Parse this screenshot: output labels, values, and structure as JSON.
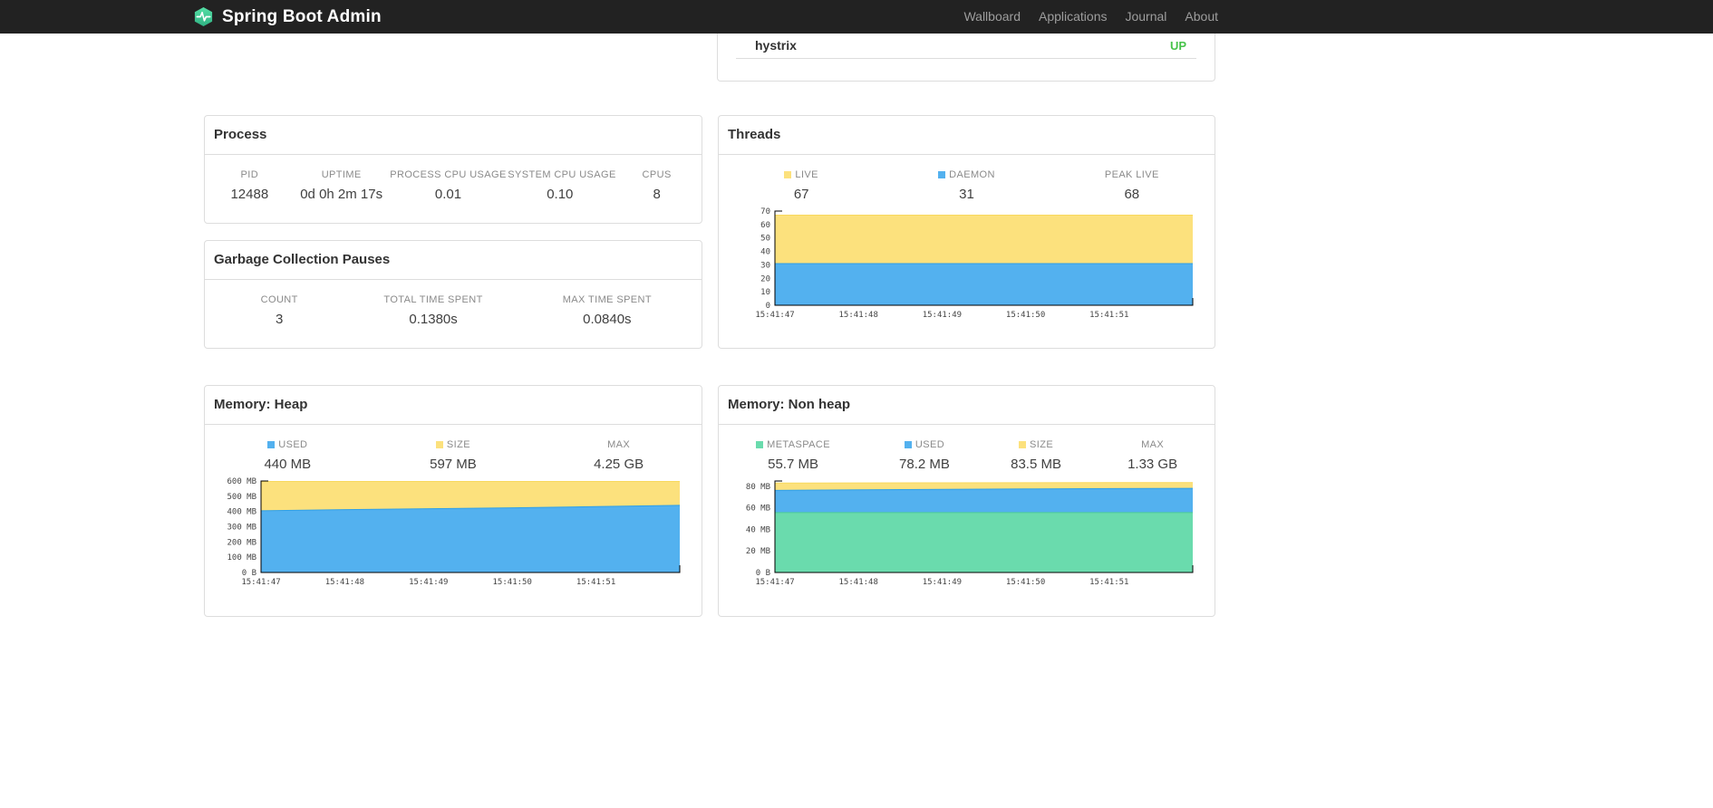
{
  "navbar": {
    "brand": "Spring Boot Admin",
    "links": [
      {
        "label": "Wallboard"
      },
      {
        "label": "Applications"
      },
      {
        "label": "Journal"
      },
      {
        "label": "About"
      }
    ]
  },
  "health": {
    "service": "hystrix",
    "status": "UP",
    "status_color": "#47c34a"
  },
  "process": {
    "title": "Process",
    "stats": [
      {
        "label": "PID",
        "value": "12488"
      },
      {
        "label": "UPTIME",
        "value": "0d 0h 2m 17s"
      },
      {
        "label": "PROCESS CPU USAGE",
        "value": "0.01"
      },
      {
        "label": "SYSTEM CPU USAGE",
        "value": "0.10"
      },
      {
        "label": "CPUS",
        "value": "8"
      }
    ]
  },
  "gc": {
    "title": "Garbage Collection Pauses",
    "stats": [
      {
        "label": "COUNT",
        "value": "3"
      },
      {
        "label": "TOTAL TIME SPENT",
        "value": "0.1380s"
      },
      {
        "label": "MAX TIME SPENT",
        "value": "0.0840s"
      }
    ]
  },
  "threads": {
    "title": "Threads",
    "stats": [
      {
        "label": "LIVE",
        "value": "67",
        "color": "#fce17d"
      },
      {
        "label": "DAEMON",
        "value": "31",
        "color": "#53b1ef"
      },
      {
        "label": "PEAK LIVE",
        "value": "68"
      }
    ],
    "chart": {
      "type": "area",
      "x_labels": [
        "15:41:47",
        "15:41:48",
        "15:41:49",
        "15:41:50",
        "15:41:51"
      ],
      "y_max": 70,
      "y_ticks": [
        {
          "v": 0,
          "t": "0"
        },
        {
          "v": 10,
          "t": "10"
        },
        {
          "v": 20,
          "t": "20"
        },
        {
          "v": 30,
          "t": "30"
        },
        {
          "v": 40,
          "t": "40"
        },
        {
          "v": 50,
          "t": "50"
        },
        {
          "v": 60,
          "t": "60"
        },
        {
          "v": 70,
          "t": "70"
        }
      ],
      "series": [
        {
          "name": "DAEMON",
          "color": "#53b1ef",
          "line": "#2e9fe8",
          "values": [
            31,
            31,
            31,
            31,
            31,
            31
          ]
        },
        {
          "name": "LIVE",
          "color": "#fce17d",
          "line": "#f8d95e",
          "values": [
            67,
            67,
            67,
            67,
            67,
            67
          ]
        }
      ]
    }
  },
  "heap": {
    "title": "Memory: Heap",
    "stats": [
      {
        "label": "USED",
        "value": "440 MB",
        "color": "#53b1ef"
      },
      {
        "label": "SIZE",
        "value": "597 MB",
        "color": "#fce17d"
      },
      {
        "label": "MAX",
        "value": "4.25 GB"
      }
    ],
    "chart": {
      "type": "area",
      "x_labels": [
        "15:41:47",
        "15:41:48",
        "15:41:49",
        "15:41:50",
        "15:41:51"
      ],
      "y_max": 600,
      "y_ticks": [
        {
          "v": 0,
          "t": "0 B"
        },
        {
          "v": 100,
          "t": "100 MB"
        },
        {
          "v": 200,
          "t": "200 MB"
        },
        {
          "v": 300,
          "t": "300 MB"
        },
        {
          "v": 400,
          "t": "400 MB"
        },
        {
          "v": 500,
          "t": "500 MB"
        },
        {
          "v": 600,
          "t": "600 MB"
        }
      ],
      "series": [
        {
          "name": "USED",
          "color": "#53b1ef",
          "line": "#2e9fe8",
          "values": [
            405,
            412,
            418,
            424,
            432,
            440
          ]
        },
        {
          "name": "SIZE",
          "color": "#fce17d",
          "line": "#f8d95e",
          "values": [
            597,
            597,
            597,
            597,
            597,
            597
          ]
        }
      ]
    }
  },
  "nonheap": {
    "title": "Memory: Non heap",
    "stats": [
      {
        "label": "METASPACE",
        "value": "55.7 MB",
        "color": "#6adbad"
      },
      {
        "label": "USED",
        "value": "78.2 MB",
        "color": "#53b1ef"
      },
      {
        "label": "SIZE",
        "value": "83.5 MB",
        "color": "#fce17d"
      },
      {
        "label": "MAX",
        "value": "1.33 GB"
      }
    ],
    "chart": {
      "type": "area",
      "x_labels": [
        "15:41:47",
        "15:41:48",
        "15:41:49",
        "15:41:50",
        "15:41:51"
      ],
      "y_max": 85,
      "y_ticks": [
        {
          "v": 0,
          "t": "0 B"
        },
        {
          "v": 20,
          "t": "20 MB"
        },
        {
          "v": 40,
          "t": "40 MB"
        },
        {
          "v": 60,
          "t": "60 MB"
        },
        {
          "v": 80,
          "t": "80 MB"
        }
      ],
      "series": [
        {
          "name": "METASPACE",
          "color": "#6adbad",
          "line": "#4fce97",
          "values": [
            55.7,
            55.7,
            55.7,
            55.7,
            55.7,
            55.7
          ]
        },
        {
          "name": "USED",
          "color": "#53b1ef",
          "line": "#2e9fe8",
          "values": [
            76.3,
            76.8,
            77.2,
            77.6,
            77.9,
            78.2
          ]
        },
        {
          "name": "SIZE",
          "color": "#fce17d",
          "line": "#f8d95e",
          "values": [
            83.1,
            83.2,
            83.3,
            83.4,
            83.5,
            83.5
          ]
        }
      ]
    }
  }
}
